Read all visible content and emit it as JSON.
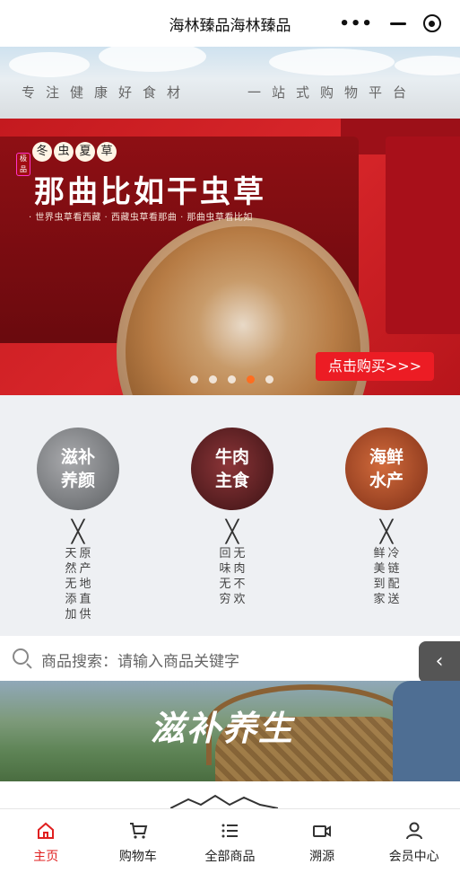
{
  "window": {
    "title": "海林臻品海林臻品"
  },
  "slogan": {
    "left": "专注健康好食材",
    "right": "一站式购物平台"
  },
  "banner": {
    "badges": [
      "冬",
      "虫",
      "夏",
      "草"
    ],
    "seal": "极品",
    "headline": "那曲比如干虫草",
    "subline": "· 世界虫草看西藏 · 西藏虫草看那曲 · 那曲虫草看比如",
    "button": "点击购买>>>",
    "slides": 5,
    "active_slide": 4
  },
  "categories": [
    {
      "label_line1": "滋补",
      "label_line2": "养颜",
      "mark": "╳",
      "notes": [
        "天然无添加",
        "原产地直供"
      ],
      "color": "#6b6e72"
    },
    {
      "label_line1": "牛肉",
      "label_line2": "主食",
      "mark": "╳",
      "notes": [
        "回味无穷",
        "无肉不欢"
      ],
      "color": "#4a1c1e"
    },
    {
      "label_line1": "海鲜",
      "label_line2": "水产",
      "mark": "╳",
      "notes": [
        "鲜美到家",
        "冷链配送"
      ],
      "color": "#9a3f22"
    }
  ],
  "search": {
    "label": "商品搜索：请输入商品关键字",
    "back_icon": "chevron-left-icon"
  },
  "section_banner": {
    "title": "滋补养生"
  },
  "tabbar": [
    {
      "label": "主页",
      "icon": "home-icon",
      "active": true
    },
    {
      "label": "购物车",
      "icon": "cart-icon",
      "active": false
    },
    {
      "label": "全部商品",
      "icon": "list-icon",
      "active": false
    },
    {
      "label": "溯源",
      "icon": "video-icon",
      "active": false
    },
    {
      "label": "会员中心",
      "icon": "user-icon",
      "active": false
    }
  ]
}
